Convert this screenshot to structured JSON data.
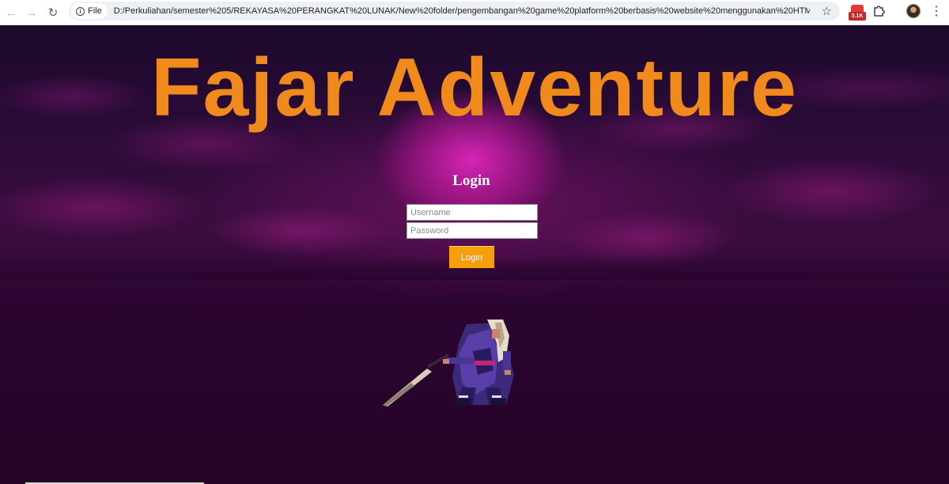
{
  "browser": {
    "site_chip_label": "File",
    "url": "D:/Perkuliahan/semester%205/REKAYASA%20PERANGKAT%20LUNAK/New%20folder/pengembangan%20game%20platform%20berbasis%20website%20menggunakan%20HTML5%...",
    "extension_badge": "3.1K",
    "icons": [
      "back-icon",
      "forward-icon",
      "reload-icon",
      "info-icon",
      "star-icon",
      "extension-icon",
      "puzzle-icon",
      "avatar",
      "menu-icon"
    ]
  },
  "page": {
    "game_title": "Fajar Adventure",
    "login_heading": "Login",
    "username_placeholder": "Username",
    "password_placeholder": "Password",
    "login_button_label": "Login"
  },
  "colors": {
    "title_orange": "#f08a1c",
    "button_orange": "#f5a00b",
    "background_purple": "#2a0a2e"
  }
}
